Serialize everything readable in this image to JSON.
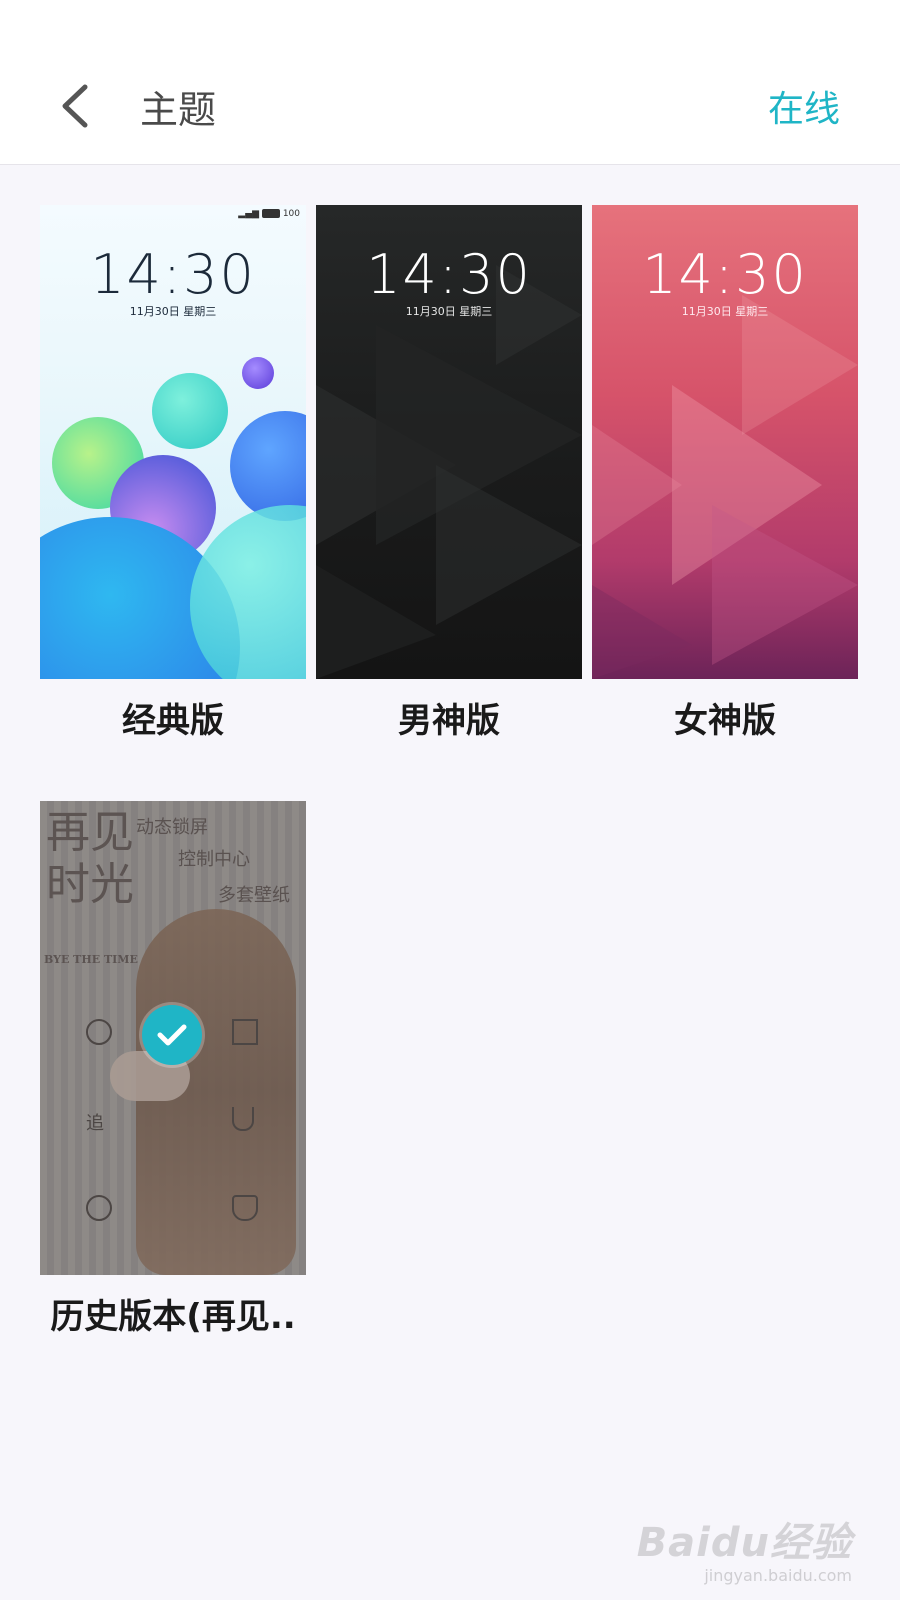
{
  "header": {
    "title": "主题",
    "online_label": "在线",
    "back_icon": "chevron-left-icon"
  },
  "themes": [
    {
      "label": "经典版",
      "preview": {
        "time": "14:30",
        "date": "11月30日 星期三",
        "status": "100"
      }
    },
    {
      "label": "男神版",
      "preview": {
        "time": "14:30",
        "date": "11月30日 星期三"
      }
    },
    {
      "label": "女神版",
      "preview": {
        "time": "14:30",
        "date": "11月30日 星期三"
      }
    },
    {
      "label": "历史版本(再见..",
      "selected": true,
      "preview": {
        "title_art": "再见时光",
        "subtitle": "BYE THE TIME",
        "features": [
          "动态锁屏",
          "控制中心",
          "多套壁纸"
        ],
        "icon_text": "追"
      }
    }
  ],
  "watermark": {
    "logo": "Baidu经验",
    "url": "jingyan.baidu.com"
  },
  "colors": {
    "accent": "#1fb5c6",
    "title": "#4a4a4a",
    "label": "#1a1a1a",
    "background": "#f7f6fb"
  }
}
